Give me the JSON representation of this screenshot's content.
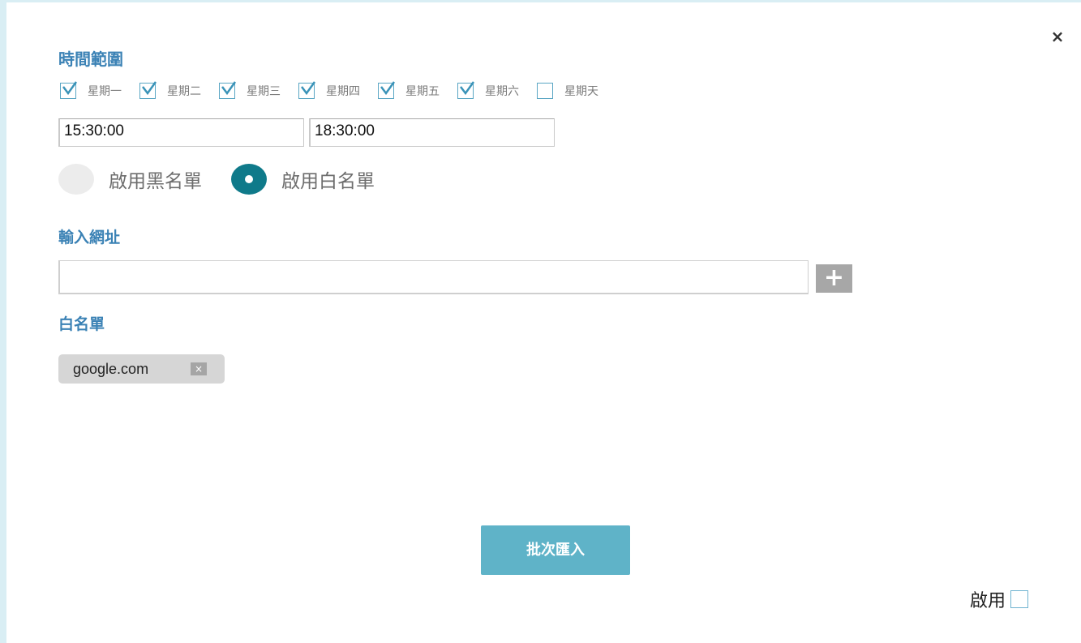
{
  "dialog": {
    "close_label": "×",
    "time_range_title": "時間範圍",
    "days": [
      {
        "label": "星期一",
        "checked": true
      },
      {
        "label": "星期二",
        "checked": true
      },
      {
        "label": "星期三",
        "checked": true
      },
      {
        "label": "星期四",
        "checked": true
      },
      {
        "label": "星期五",
        "checked": true
      },
      {
        "label": "星期六",
        "checked": true
      },
      {
        "label": "星期天",
        "checked": false
      }
    ],
    "start_time": "15:30:00",
    "end_time": "18:30:00",
    "mode_options": [
      {
        "label": "啟用黑名單",
        "selected": false
      },
      {
        "label": "啟用白名單",
        "selected": true
      }
    ],
    "url_title": "輸入網址",
    "url_value": "",
    "add_label": "+",
    "whitelist_title": "白名單",
    "whitelist": [
      {
        "domain": "google.com",
        "remove_label": "×"
      }
    ],
    "import_label": "批次匯入",
    "enable_label": "啟用",
    "enable_checked": false
  },
  "colors": {
    "accent": "#3b82b5",
    "radio_selected": "#0f7a8a",
    "button": "#5fb3c8",
    "checkbox_border": "#5aa6c4"
  }
}
